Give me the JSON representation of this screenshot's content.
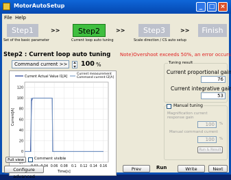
{
  "window": {
    "title": "MotorAutoSetup"
  },
  "menu": {
    "file": "File",
    "help": "Help"
  },
  "steps": [
    {
      "label": "Step1",
      "caption": "Set of the basic parameter"
    },
    {
      "label": "Step2",
      "caption": "Current loop auto tuning"
    },
    {
      "label": "Step3",
      "caption": "Scale direction / CS auto setup"
    },
    {
      "label": "Finish",
      "caption": ""
    }
  ],
  "arrow": ">>",
  "page": {
    "heading": "Step2 : Current loop auto tuning",
    "note": "Note)Overshoot exceeds 50%, an error occurs."
  },
  "command": {
    "button": "Command current >>",
    "value": "100",
    "unit": "%"
  },
  "chart_data": {
    "type": "line",
    "legend_left": "Current Actual Value I1[A]",
    "legend_right": "Current measurement\nCommand current I2[A]",
    "series": [
      {
        "name": "Current Actual Value I1[A]",
        "color": "#1f3a93",
        "x": [
          0.0,
          0.008,
          0.012,
          0.014,
          0.016,
          0.056,
          0.057,
          0.065,
          0.068,
          0.16
        ],
        "y": [
          0,
          0,
          0,
          95,
          100,
          100,
          0,
          0,
          0,
          0
        ]
      },
      {
        "name": "Command current I2[A]",
        "color": "#7fa0c8",
        "x": [
          0.0,
          0.013,
          0.0131,
          0.0565,
          0.0566,
          0.16
        ],
        "y": [
          0,
          0,
          100,
          100,
          0,
          0
        ]
      }
    ],
    "xticks": [
      "0.02",
      "0.04",
      "0.06",
      "0.08",
      "0.1",
      "0.12",
      "0.14",
      "0.16"
    ],
    "yticks": [
      "120",
      "100",
      "80",
      "60",
      "40",
      "20",
      "0",
      "-20"
    ],
    "xlabel": "Time[s]",
    "ylabel": "Current[A]",
    "xlim": [
      0.0,
      0.17
    ],
    "ylim": [
      -20,
      130
    ]
  },
  "tuning": {
    "group": "Tuning result",
    "prop_label": "Current proportional gain",
    "prop_value": "76",
    "int_label": "Current integrative gain",
    "int_value": "53"
  },
  "manual": {
    "label": "Manual tuning",
    "mag_label": "Magnification current response gain",
    "mag_value": "100",
    "mag_unit": "%",
    "cmd_label": "Manual command current",
    "cmd_value": "100",
    "cmd_unit": "%",
    "run_result": "Run & Result"
  },
  "view": {
    "full": "Full view",
    "comment": "Comment visible"
  },
  "buttons": {
    "configure": "Configure advanced",
    "prev": "Prev",
    "run": "Run",
    "write": "Write",
    "next": "Next"
  }
}
